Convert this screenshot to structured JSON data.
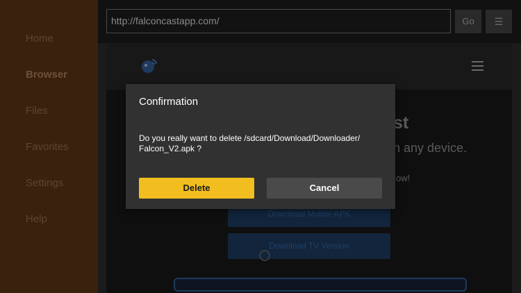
{
  "sidebar": {
    "items": [
      {
        "label": "Home",
        "active": false
      },
      {
        "label": "Browser",
        "active": true
      },
      {
        "label": "Files",
        "active": false
      },
      {
        "label": "Favorites",
        "active": false
      },
      {
        "label": "Settings",
        "active": false
      },
      {
        "label": "Help",
        "active": false
      }
    ]
  },
  "toolbar": {
    "url_value": "http://falconcastapp.com/",
    "go_label": "Go",
    "menu_icon": "menu-icon"
  },
  "web": {
    "logo_icon": "falcon-logo-icon",
    "hero_partial_1": "st",
    "hero_partial_2": "n any device.",
    "hero_partial_3": "ow!",
    "download_mobile_label": "Download Mobile APK",
    "download_tv_label": "Download TV Version"
  },
  "dialog": {
    "title": "Confirmation",
    "message_line1": "Do you really want to delete /sdcard/Download/Downloader/",
    "message_line2": "Falcon_V2.apk ?",
    "delete_label": "Delete",
    "cancel_label": "Cancel"
  },
  "colors": {
    "sidebar_bg": "#3a210d",
    "accent": "#f2be1f",
    "dialog_bg": "#313131"
  }
}
